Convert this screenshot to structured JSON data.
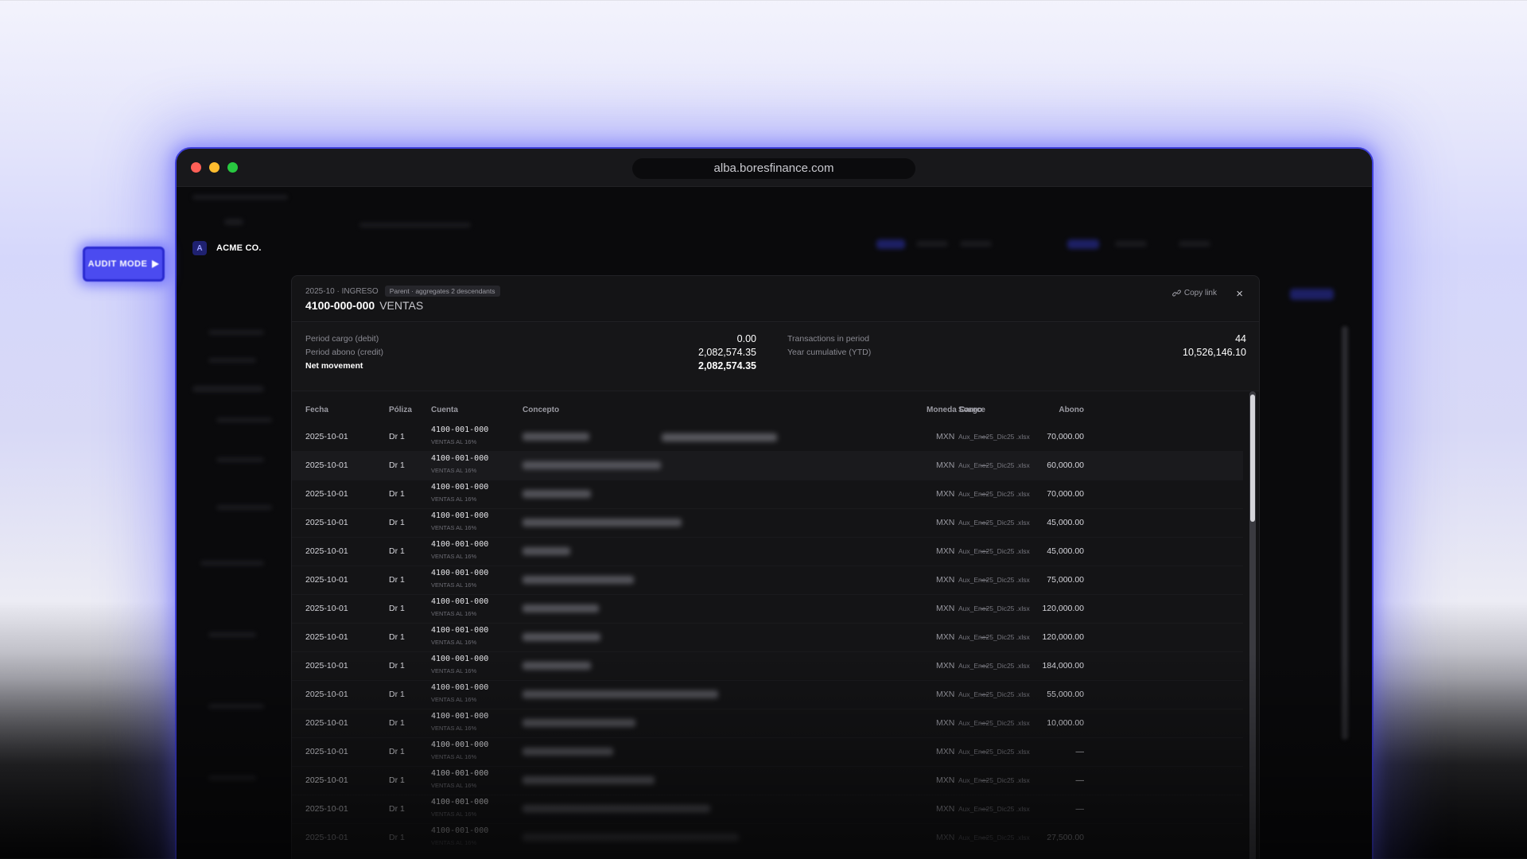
{
  "browser": {
    "url": "alba.boresfinance.com"
  },
  "brand": {
    "badge": "A",
    "name": "ACME CO."
  },
  "audit_button": {
    "label": "AUDIT MODE",
    "icon": "play-triangle-icon"
  },
  "modal": {
    "crumb": "2025-10 · INGRESO",
    "parent_badge": "Parent · aggregates 2 descendants",
    "account_code": "4100-000-000",
    "account_name": "VENTAS",
    "copy_link": "Copy link",
    "close_icon": "×",
    "summary": {
      "cargo_label": "Period cargo (debit)",
      "cargo_value": "0.00",
      "abono_label": "Period abono (credit)",
      "abono_value": "2,082,574.35",
      "net_label": "Net movement",
      "net_value": "2,082,574.35",
      "tx_label": "Transactions in period",
      "tx_value": "44",
      "ytd_label": "Year cumulative (YTD)",
      "ytd_value": "10,526,146.10"
    },
    "columns": {
      "fecha": "Fecha",
      "poliza": "Póliza",
      "cuenta": "Cuenta",
      "concepto": "Concepto",
      "cargo": "Cargo",
      "abono": "Abono",
      "moneda": "Moneda",
      "source": "Source"
    },
    "rows": [
      {
        "date": "2025-10-01",
        "poliza": "Dr 1",
        "cuenta": "4100-001-000",
        "cuenta_sub": "VENTAS AL 16%",
        "cargo": "—",
        "abono": "70,000.00",
        "moneda": "MXN",
        "source": "Aux_Ene25_Dic25 .xlsx",
        "concepto_blur": 0.42
      },
      {
        "date": "2025-10-01",
        "poliza": "Dr 1",
        "cuenta": "4100-001-000",
        "cuenta_sub": "VENTAS AL 16%",
        "cargo": "—",
        "abono": "60,000.00",
        "moneda": "MXN",
        "source": "Aux_Ene25_Dic25 .xlsx",
        "concepto_blur": 0.87
      },
      {
        "date": "2025-10-01",
        "poliza": "Dr 1",
        "cuenta": "4100-001-000",
        "cuenta_sub": "VENTAS AL 16%",
        "cargo": "—",
        "abono": "70,000.00",
        "moneda": "MXN",
        "source": "Aux_Ene25_Dic25 .xlsx",
        "concepto_blur": 0.43
      },
      {
        "date": "2025-10-01",
        "poliza": "Dr 1",
        "cuenta": "4100-001-000",
        "cuenta_sub": "VENTAS AL 16%",
        "cargo": "—",
        "abono": "45,000.00",
        "moneda": "MXN",
        "source": "Aux_Ene25_Dic25 .xlsx",
        "concepto_blur": 1.0
      },
      {
        "date": "2025-10-01",
        "poliza": "Dr 1",
        "cuenta": "4100-001-000",
        "cuenta_sub": "VENTAS AL 16%",
        "cargo": "—",
        "abono": "45,000.00",
        "moneda": "MXN",
        "source": "Aux_Ene25_Dic25 .xlsx",
        "concepto_blur": 0.3
      },
      {
        "date": "2025-10-01",
        "poliza": "Dr 1",
        "cuenta": "4100-001-000",
        "cuenta_sub": "VENTAS AL 16%",
        "cargo": "—",
        "abono": "75,000.00",
        "moneda": "MXN",
        "source": "Aux_Ene25_Dic25 .xlsx",
        "concepto_blur": 0.7
      },
      {
        "date": "2025-10-01",
        "poliza": "Dr 1",
        "cuenta": "4100-001-000",
        "cuenta_sub": "VENTAS AL 16%",
        "cargo": "—",
        "abono": "120,000.00",
        "moneda": "MXN",
        "source": "Aux_Ene25_Dic25 .xlsx",
        "concepto_blur": 0.48
      },
      {
        "date": "2025-10-01",
        "poliza": "Dr 1",
        "cuenta": "4100-001-000",
        "cuenta_sub": "VENTAS AL 16%",
        "cargo": "—",
        "abono": "120,000.00",
        "moneda": "MXN",
        "source": "Aux_Ene25_Dic25 .xlsx",
        "concepto_blur": 0.49
      },
      {
        "date": "2025-10-01",
        "poliza": "Dr 1",
        "cuenta": "4100-001-000",
        "cuenta_sub": "VENTAS AL 16%",
        "cargo": "—",
        "abono": "184,000.00",
        "moneda": "MXN",
        "source": "Aux_Ene25_Dic25 .xlsx",
        "concepto_blur": 0.43
      },
      {
        "date": "2025-10-01",
        "poliza": "Dr 1",
        "cuenta": "4100-001-000",
        "cuenta_sub": "VENTAS AL 16%",
        "cargo": "—",
        "abono": "55,000.00",
        "moneda": "MXN",
        "source": "Aux_Ene25_Dic25 .xlsx",
        "concepto_blur": 1.23
      },
      {
        "date": "2025-10-01",
        "poliza": "Dr 1",
        "cuenta": "4100-001-000",
        "cuenta_sub": "VENTAS AL 16%",
        "cargo": "—",
        "abono": "10,000.00",
        "moneda": "MXN",
        "source": "Aux_Ene25_Dic25 .xlsx",
        "concepto_blur": 0.71
      },
      {
        "date": "2025-10-01",
        "poliza": "Dr 1",
        "cuenta": "4100-001-000",
        "cuenta_sub": "VENTAS AL 16%",
        "cargo": "—",
        "abono": "—",
        "moneda": "MXN",
        "source": "Aux_Ene25_Dic25 .xlsx",
        "concepto_blur": 0.57
      },
      {
        "date": "2025-10-01",
        "poliza": "Dr 1",
        "cuenta": "4100-001-000",
        "cuenta_sub": "VENTAS AL 16%",
        "cargo": "—",
        "abono": "—",
        "moneda": "MXN",
        "source": "Aux_Ene25_Dic25 .xlsx",
        "concepto_blur": 0.83
      },
      {
        "date": "2025-10-01",
        "poliza": "Dr 1",
        "cuenta": "4100-001-000",
        "cuenta_sub": "VENTAS AL 16%",
        "cargo": "—",
        "abono": "—",
        "moneda": "MXN",
        "source": "Aux_Ene25_Dic25 .xlsx",
        "concepto_blur": 1.18
      },
      {
        "date": "2025-10-01",
        "poliza": "Dr 1",
        "cuenta": "4100-001-000",
        "cuenta_sub": "VENTAS AL 16%",
        "cargo": "—",
        "abono": "27,500.00",
        "moneda": "MXN",
        "source": "Aux_Ene25_Dic25 .xlsx",
        "concepto_blur": 1.36
      }
    ]
  }
}
